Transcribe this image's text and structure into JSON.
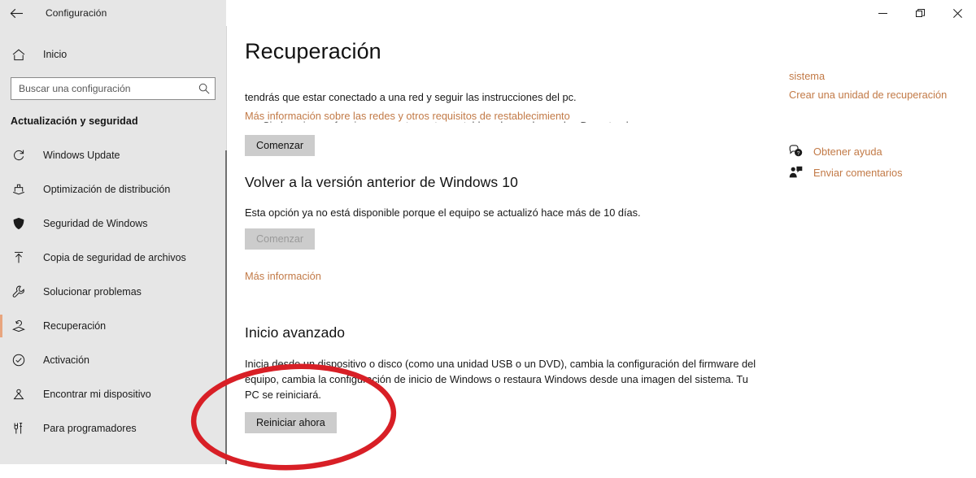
{
  "titlebar": {
    "back_icon": "back-arrow-icon",
    "title": "Configuración",
    "minimize_label": "Minimizar",
    "restore_label": "Restaurar",
    "close_label": "Cerrar"
  },
  "sidebar": {
    "home": {
      "label": "Inicio",
      "icon": "home-icon"
    },
    "search": {
      "placeholder": "Buscar una configuración",
      "value": "",
      "icon": "search-icon"
    },
    "group_title": "Actualización y seguridad",
    "items": [
      {
        "label": "Windows Update",
        "icon": "sync-icon",
        "selected": false
      },
      {
        "label": "Optimización de distribución",
        "icon": "delivery-optimization-icon",
        "selected": false
      },
      {
        "label": "Seguridad de Windows",
        "icon": "shield-icon",
        "selected": false
      },
      {
        "label": "Copia de seguridad de archivos",
        "icon": "backup-upload-icon",
        "selected": false
      },
      {
        "label": "Solucionar problemas",
        "icon": "wrench-icon",
        "selected": false
      },
      {
        "label": "Recuperación",
        "icon": "recovery-icon",
        "selected": true
      },
      {
        "label": "Activación",
        "icon": "check-circle-icon",
        "selected": false
      },
      {
        "label": "Encontrar mi dispositivo",
        "icon": "find-device-icon",
        "selected": false
      },
      {
        "label": "Para programadores",
        "icon": "developer-tools-icon",
        "selected": false
      }
    ]
  },
  "main": {
    "page_title": "Recuperación",
    "reset_section": {
      "clipped_text": "Si el equipo no funciona correctamente, restablecerlo puede ayudar. Durante el proceso",
      "description": "tendrás que estar conectado a una red y seguir las instrucciones del pc.",
      "link": "Más información sobre las redes y otros requisitos de restablecimiento",
      "button": "Comenzar"
    },
    "rollback_section": {
      "heading": "Volver a la versión anterior de Windows 10",
      "description": "Esta opción ya no está disponible porque el equipo se actualizó hace más de 10 días.",
      "button": "Comenzar",
      "button_disabled": true,
      "link": "Más información"
    },
    "advanced_section": {
      "heading": "Inicio avanzado",
      "description": "Inicia desde un dispositivo o disco (como una unidad USB o un DVD), cambia la configuración del firmware del equipo, cambia la configuración de inicio de Windows o restaura Windows desde una imagen del sistema. Tu PC se reiniciará.",
      "button": "Reiniciar ahora"
    }
  },
  "rail": {
    "links": [
      "sistema",
      "Crear una unidad de recuperación"
    ],
    "actions": [
      {
        "label": "Obtener ayuda",
        "icon": "help-bubble-icon"
      },
      {
        "label": "Enviar comentarios",
        "icon": "feedback-person-icon"
      }
    ]
  },
  "annotation": {
    "shape": "ellipse-highlight",
    "color": "#d81f26",
    "target": "Reiniciar ahora"
  },
  "colors": {
    "accent_selected": "#e8a57e",
    "link": "#c27a47",
    "sidebar_bg": "#e6e6e6",
    "button_bg": "#cccccc",
    "annotation_red": "#d81f26"
  }
}
